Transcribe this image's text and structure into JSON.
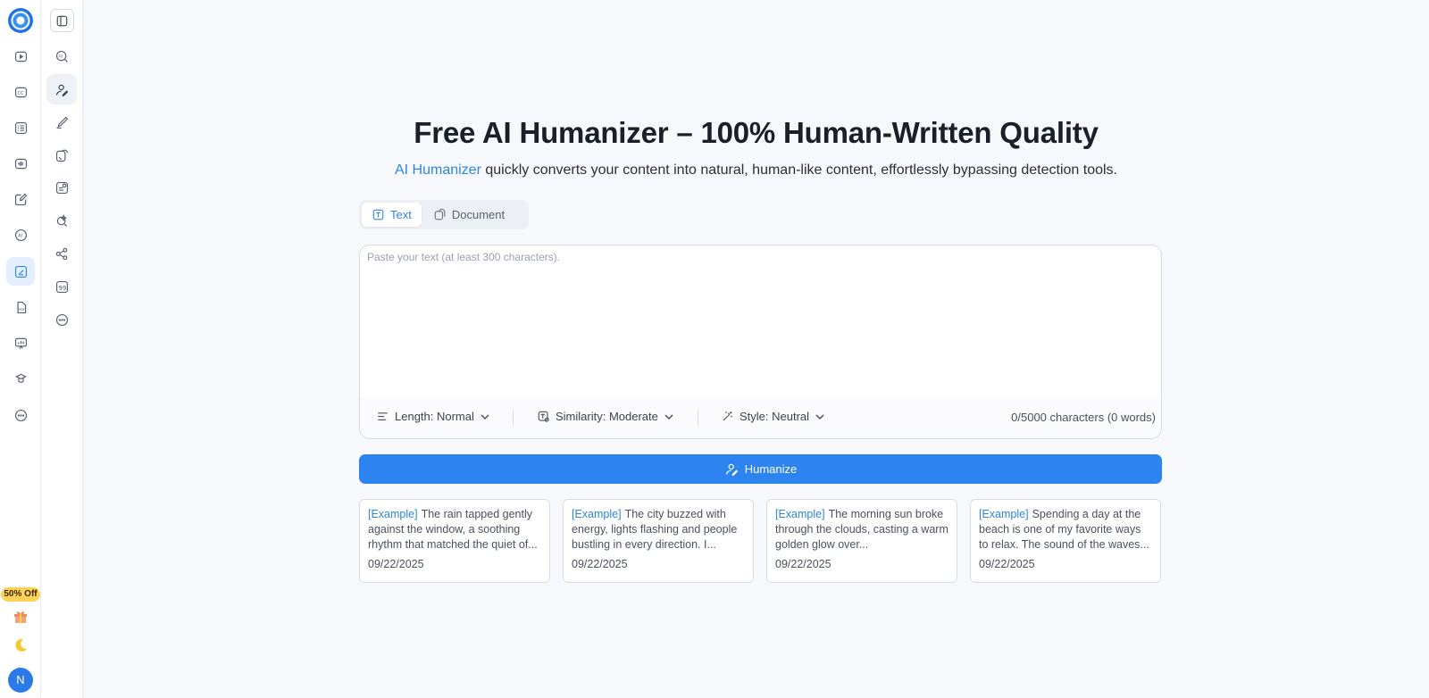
{
  "rail": {
    "icons": [
      "video-icon",
      "caption-icon",
      "list-icon",
      "audio-icon",
      "edit-icon",
      "ai-icon",
      "humanizer-icon",
      "pdf-icon",
      "presentation-icon",
      "hat-icon",
      "more-icon"
    ],
    "active_index": 6,
    "promo_label": "50% Off",
    "avatar_letter": "N"
  },
  "rail2": {
    "icons": [
      "ai-search-icon",
      "humanizer-pen-icon",
      "pen-icon",
      "paraphrase-icon",
      "grammar-icon",
      "plagiarism-icon",
      "mindmap-icon",
      "quote-icon",
      "more-icon"
    ],
    "active_index": 1
  },
  "main": {
    "title": "Free AI Humanizer – 100% Human-Written Quality",
    "subtitle_link": "AI Humanizer",
    "subtitle_rest": " quickly converts your content into natural, human-like content, effortlessly bypassing detection tools.",
    "tabs": [
      {
        "label": "Text",
        "active": true
      },
      {
        "label": "Document",
        "active": false
      }
    ],
    "editor": {
      "placeholder": "Paste your text (at least 300 characters).",
      "value": "",
      "length_label": "Length: Normal",
      "similarity_label": "Similarity: Moderate",
      "style_label": "Style: Neutral",
      "counter": "0/5000 characters (0 words)"
    },
    "humanize_label": "Humanize",
    "examples": [
      {
        "tag": "[Example]",
        "text": "The rain tapped gently against the window, a soothing rhythm that matched the quiet of...",
        "date": "09/22/2025"
      },
      {
        "tag": "[Example]",
        "text": "The city buzzed with energy, lights flashing and people bustling in every direction. I...",
        "date": "09/22/2025"
      },
      {
        "tag": "[Example]",
        "text": "The morning sun broke through the clouds, casting a warm golden glow over...",
        "date": "09/22/2025"
      },
      {
        "tag": "[Example]",
        "text": "Spending a day at the beach is one of my favorite ways to relax. The sound of the waves...",
        "date": "09/22/2025"
      }
    ]
  },
  "colors": {
    "accent": "#2d83f0",
    "link": "#2e86de",
    "background": "#f6f8fb",
    "promo": "#ffd257"
  }
}
